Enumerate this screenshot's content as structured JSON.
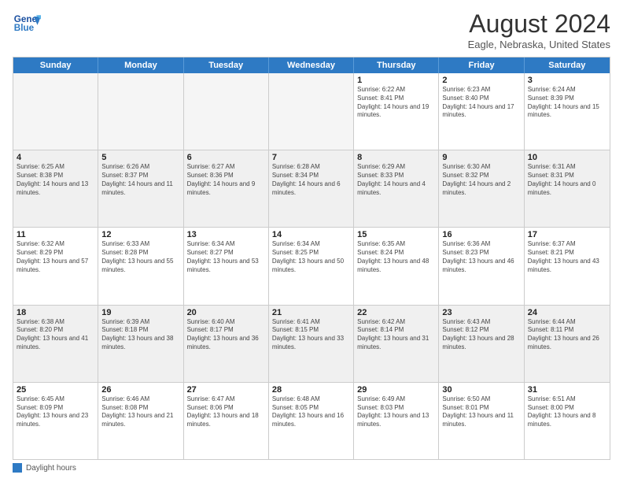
{
  "header": {
    "logo_line1": "General",
    "logo_line2": "Blue",
    "month_title": "August 2024",
    "location": "Eagle, Nebraska, United States"
  },
  "weekdays": [
    "Sunday",
    "Monday",
    "Tuesday",
    "Wednesday",
    "Thursday",
    "Friday",
    "Saturday"
  ],
  "footer": {
    "legend_label": "Daylight hours"
  },
  "weeks": [
    [
      {
        "day": "",
        "info": "",
        "empty": true
      },
      {
        "day": "",
        "info": "",
        "empty": true
      },
      {
        "day": "",
        "info": "",
        "empty": true
      },
      {
        "day": "",
        "info": "",
        "empty": true
      },
      {
        "day": "1",
        "info": "Sunrise: 6:22 AM\nSunset: 8:41 PM\nDaylight: 14 hours and 19 minutes.",
        "empty": false
      },
      {
        "day": "2",
        "info": "Sunrise: 6:23 AM\nSunset: 8:40 PM\nDaylight: 14 hours and 17 minutes.",
        "empty": false
      },
      {
        "day": "3",
        "info": "Sunrise: 6:24 AM\nSunset: 8:39 PM\nDaylight: 14 hours and 15 minutes.",
        "empty": false
      }
    ],
    [
      {
        "day": "4",
        "info": "Sunrise: 6:25 AM\nSunset: 8:38 PM\nDaylight: 14 hours and 13 minutes.",
        "empty": false
      },
      {
        "day": "5",
        "info": "Sunrise: 6:26 AM\nSunset: 8:37 PM\nDaylight: 14 hours and 11 minutes.",
        "empty": false
      },
      {
        "day": "6",
        "info": "Sunrise: 6:27 AM\nSunset: 8:36 PM\nDaylight: 14 hours and 9 minutes.",
        "empty": false
      },
      {
        "day": "7",
        "info": "Sunrise: 6:28 AM\nSunset: 8:34 PM\nDaylight: 14 hours and 6 minutes.",
        "empty": false
      },
      {
        "day": "8",
        "info": "Sunrise: 6:29 AM\nSunset: 8:33 PM\nDaylight: 14 hours and 4 minutes.",
        "empty": false
      },
      {
        "day": "9",
        "info": "Sunrise: 6:30 AM\nSunset: 8:32 PM\nDaylight: 14 hours and 2 minutes.",
        "empty": false
      },
      {
        "day": "10",
        "info": "Sunrise: 6:31 AM\nSunset: 8:31 PM\nDaylight: 14 hours and 0 minutes.",
        "empty": false
      }
    ],
    [
      {
        "day": "11",
        "info": "Sunrise: 6:32 AM\nSunset: 8:29 PM\nDaylight: 13 hours and 57 minutes.",
        "empty": false
      },
      {
        "day": "12",
        "info": "Sunrise: 6:33 AM\nSunset: 8:28 PM\nDaylight: 13 hours and 55 minutes.",
        "empty": false
      },
      {
        "day": "13",
        "info": "Sunrise: 6:34 AM\nSunset: 8:27 PM\nDaylight: 13 hours and 53 minutes.",
        "empty": false
      },
      {
        "day": "14",
        "info": "Sunrise: 6:34 AM\nSunset: 8:25 PM\nDaylight: 13 hours and 50 minutes.",
        "empty": false
      },
      {
        "day": "15",
        "info": "Sunrise: 6:35 AM\nSunset: 8:24 PM\nDaylight: 13 hours and 48 minutes.",
        "empty": false
      },
      {
        "day": "16",
        "info": "Sunrise: 6:36 AM\nSunset: 8:23 PM\nDaylight: 13 hours and 46 minutes.",
        "empty": false
      },
      {
        "day": "17",
        "info": "Sunrise: 6:37 AM\nSunset: 8:21 PM\nDaylight: 13 hours and 43 minutes.",
        "empty": false
      }
    ],
    [
      {
        "day": "18",
        "info": "Sunrise: 6:38 AM\nSunset: 8:20 PM\nDaylight: 13 hours and 41 minutes.",
        "empty": false
      },
      {
        "day": "19",
        "info": "Sunrise: 6:39 AM\nSunset: 8:18 PM\nDaylight: 13 hours and 38 minutes.",
        "empty": false
      },
      {
        "day": "20",
        "info": "Sunrise: 6:40 AM\nSunset: 8:17 PM\nDaylight: 13 hours and 36 minutes.",
        "empty": false
      },
      {
        "day": "21",
        "info": "Sunrise: 6:41 AM\nSunset: 8:15 PM\nDaylight: 13 hours and 33 minutes.",
        "empty": false
      },
      {
        "day": "22",
        "info": "Sunrise: 6:42 AM\nSunset: 8:14 PM\nDaylight: 13 hours and 31 minutes.",
        "empty": false
      },
      {
        "day": "23",
        "info": "Sunrise: 6:43 AM\nSunset: 8:12 PM\nDaylight: 13 hours and 28 minutes.",
        "empty": false
      },
      {
        "day": "24",
        "info": "Sunrise: 6:44 AM\nSunset: 8:11 PM\nDaylight: 13 hours and 26 minutes.",
        "empty": false
      }
    ],
    [
      {
        "day": "25",
        "info": "Sunrise: 6:45 AM\nSunset: 8:09 PM\nDaylight: 13 hours and 23 minutes.",
        "empty": false
      },
      {
        "day": "26",
        "info": "Sunrise: 6:46 AM\nSunset: 8:08 PM\nDaylight: 13 hours and 21 minutes.",
        "empty": false
      },
      {
        "day": "27",
        "info": "Sunrise: 6:47 AM\nSunset: 8:06 PM\nDaylight: 13 hours and 18 minutes.",
        "empty": false
      },
      {
        "day": "28",
        "info": "Sunrise: 6:48 AM\nSunset: 8:05 PM\nDaylight: 13 hours and 16 minutes.",
        "empty": false
      },
      {
        "day": "29",
        "info": "Sunrise: 6:49 AM\nSunset: 8:03 PM\nDaylight: 13 hours and 13 minutes.",
        "empty": false
      },
      {
        "day": "30",
        "info": "Sunrise: 6:50 AM\nSunset: 8:01 PM\nDaylight: 13 hours and 11 minutes.",
        "empty": false
      },
      {
        "day": "31",
        "info": "Sunrise: 6:51 AM\nSunset: 8:00 PM\nDaylight: 13 hours and 8 minutes.",
        "empty": false
      }
    ]
  ]
}
